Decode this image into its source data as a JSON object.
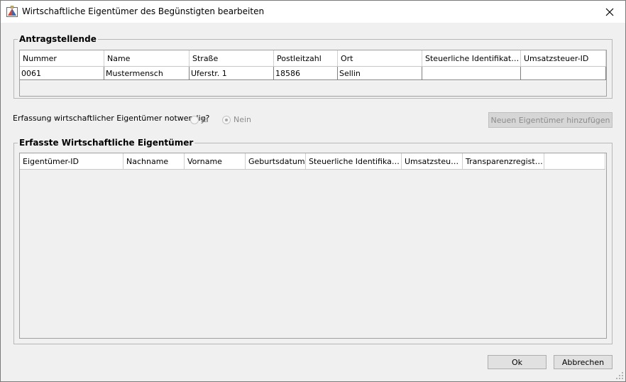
{
  "window": {
    "title": "Wirtschaftliche Eigentümer des Begünstigten bearbeiten"
  },
  "applicants": {
    "legend": "Antragstellende",
    "columns": [
      "Nummer",
      "Name",
      "Straße",
      "Postleitzahl",
      "Ort",
      "Steuerliche Identifikation",
      "Umsatzsteuer-ID"
    ],
    "rows": [
      [
        "0061",
        "Mustermensch",
        "Uferstr. 1",
        "18586",
        "Sellin",
        "",
        ""
      ]
    ]
  },
  "question": {
    "label": "Erfassung wirtschaftlicher Eigentümer notwendig?",
    "options": [
      {
        "label": "Ja",
        "selected": false
      },
      {
        "label": "Nein",
        "selected": true
      }
    ]
  },
  "add_button": {
    "label": "Neuen Eigentümer hinzufügen",
    "enabled": false
  },
  "owners": {
    "legend": "Erfasste Wirtschaftliche Eigentümer",
    "columns": [
      "Eigentümer-ID",
      "Nachname",
      "Vorname",
      "Geburtsdatum",
      "Steuerliche Identifikation",
      "Umsatzsteue...",
      "Transparenzregiste..."
    ],
    "rows": []
  },
  "footer": {
    "ok_label": "Ok",
    "cancel_label": "Abbrechen"
  },
  "icons": {
    "app": "app-icon",
    "close": "close-icon"
  }
}
